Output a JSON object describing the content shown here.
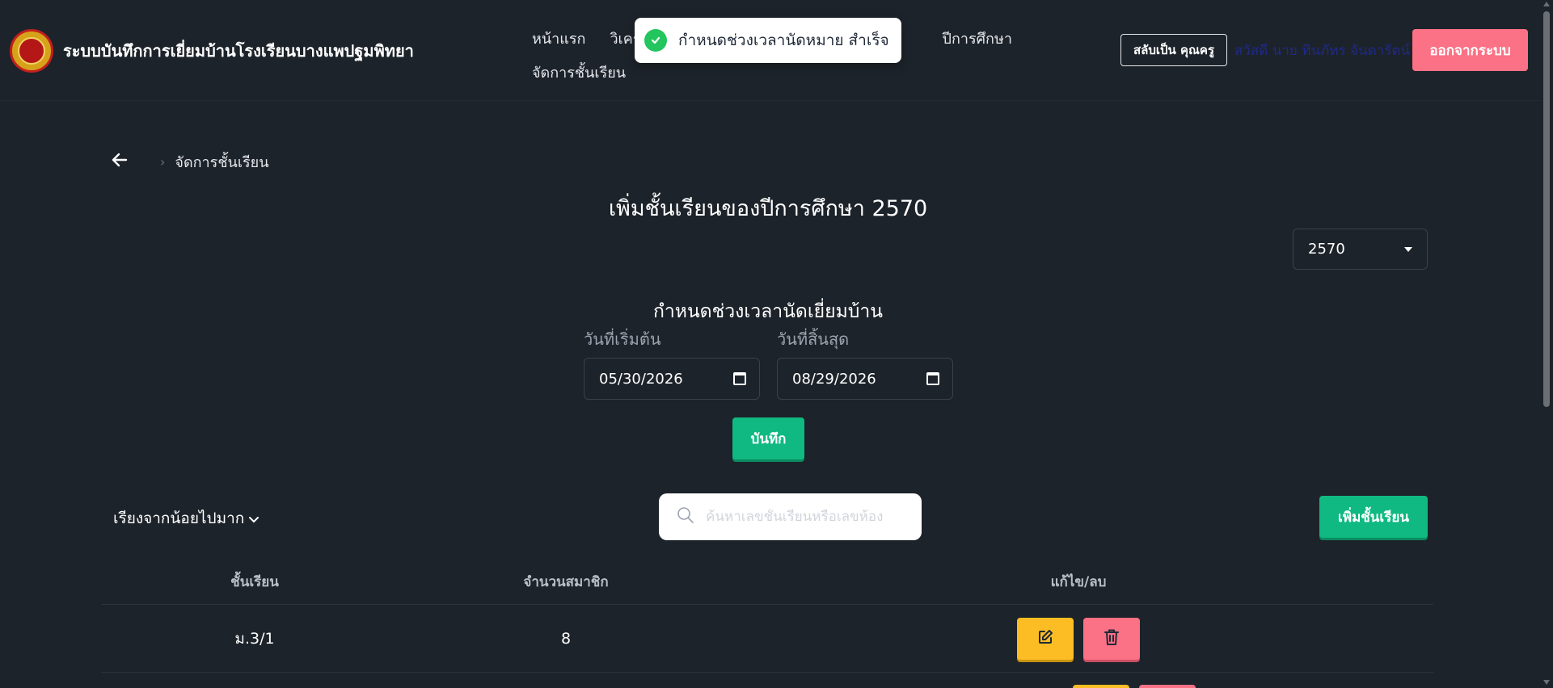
{
  "header": {
    "title": "ระบบบันทึกการเยี่ยมบ้านโรงเรียนบางแพปฐมพิทยา",
    "nav_items": [
      "หน้าแรก",
      "วิเครา",
      "ปีการศึกษา",
      "จัดการชั้นเรียน"
    ],
    "switch_label": "สลับเป็น คุณครู",
    "greeting": "สวัสดี นาย ทินภัทร จันดารัตน์",
    "logout_label": "ออกจากระบบ"
  },
  "toast": {
    "message": "กำหนดช่วงเวลานัดหมาย สำเร็จ",
    "icon": "check-circle-icon"
  },
  "breadcrumb": {
    "current": "จัดการชั้นเรียน"
  },
  "page": {
    "title": "เพิ่มชั้นเรียนของปีการศึกษา 2570",
    "year_selected": "2570"
  },
  "schedule": {
    "title": "กำหนดช่วงเวลานัดเยี่ยมบ้าน",
    "start_label": "วันที่เริ่มต้น",
    "start_value": "05/30/2026",
    "end_label": "วันที่สิ้นสุด",
    "end_value": "08/29/2026",
    "save_label": "บันทึก"
  },
  "toolbar": {
    "sort_label": "เรียงจากน้อยไปมาก",
    "search_placeholder": "ค้นหาเลขชั้นเรียนหรือเลขห้อง",
    "add_label": "เพิ่มชั้นเรียน"
  },
  "table": {
    "headers": [
      "ชั้นเรียน",
      "จำนวนสมาชิก",
      "แก้ไข/ลบ"
    ],
    "rows": [
      {
        "class_name": "ม.3/1",
        "members": "8"
      }
    ]
  },
  "colors": {
    "background": "#1d232a",
    "success": "#10b981",
    "warning": "#fbbd23",
    "danger": "#fb7185"
  }
}
